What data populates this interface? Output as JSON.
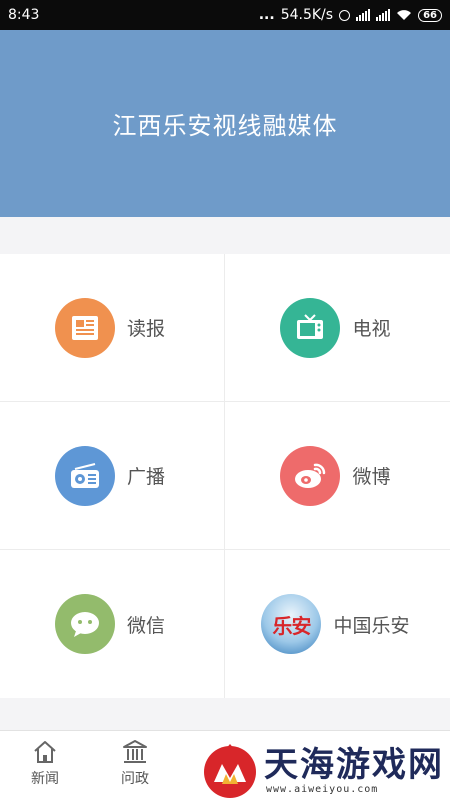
{
  "status_bar": {
    "time": "8:43",
    "dots": "...",
    "speed": "54.5K/s",
    "battery": "66"
  },
  "header": {
    "title": "江西乐安视线融媒体"
  },
  "grid": {
    "items": [
      {
        "label": "读报",
        "icon": "newspaper-icon",
        "color": "#f0914f"
      },
      {
        "label": "电视",
        "icon": "tv-icon",
        "color": "#35b595"
      },
      {
        "label": "广播",
        "icon": "radio-icon",
        "color": "#5e97d6"
      },
      {
        "label": "微博",
        "icon": "weibo-icon",
        "color": "#ee6b6b"
      },
      {
        "label": "微信",
        "icon": "wechat-icon",
        "color": "#93bb6c"
      },
      {
        "label": "中国乐安",
        "icon": "lean-logo-icon",
        "color": "#3f88c9",
        "logo_text": "乐安"
      }
    ]
  },
  "tabbar": {
    "tabs": [
      {
        "label": "新闻",
        "icon": "home-icon"
      },
      {
        "label": "问政",
        "icon": "government-icon"
      }
    ]
  },
  "watermark": {
    "main": "天海游戏网",
    "sub": "www.aiweiyou.com"
  }
}
